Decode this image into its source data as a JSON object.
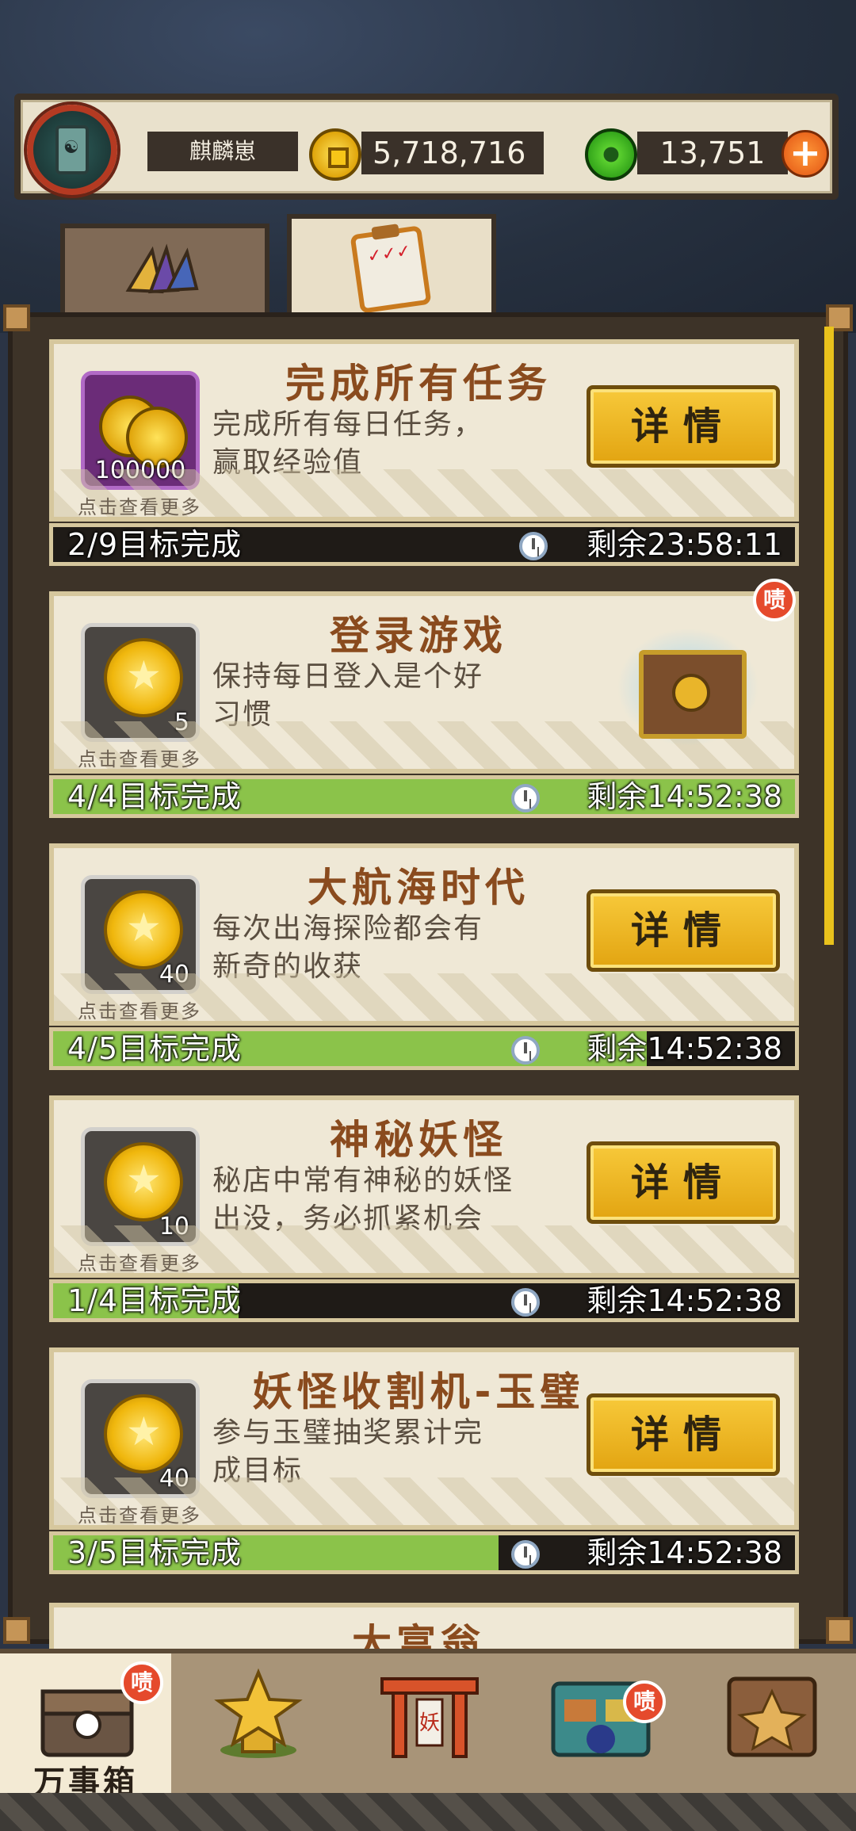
{
  "header": {
    "player_name": "麒麟崽",
    "gold": "5,718,716",
    "jade": "13,751",
    "plus_symbol": "+"
  },
  "tabs": [
    {
      "icon": "fan-icon",
      "active": false
    },
    {
      "icon": "clipboard-icon",
      "active": true
    }
  ],
  "clipboard_marks": "✓✓✓",
  "missions": [
    {
      "title": "完成所有任务",
      "desc_line1": "完成所有每日任务，",
      "desc_line2": "赢取经验值",
      "reward_count": "100000",
      "reward_icon": "coins-icon",
      "more_hint": "点击查看更多",
      "action": "详情",
      "progress_text": "2/9目标完成",
      "time_text": "剩余23:58:11",
      "progress": 0.0
    },
    {
      "title": "登录游戏",
      "desc_line1": "保持每日登入是个好",
      "desc_line2": "习惯",
      "reward_count": "5",
      "reward_icon": "medal-icon",
      "more_hint": "点击查看更多",
      "action_icon": "treasure-chest-icon",
      "badge": "啧",
      "progress_text": "4/4目标完成",
      "time_text": "剩余14:52:38",
      "progress": 1.0
    },
    {
      "title": "大航海时代",
      "desc_line1": "每次出海探险都会有",
      "desc_line2": "新奇的收获",
      "reward_count": "40",
      "reward_icon": "medal-icon",
      "more_hint": "点击查看更多",
      "action": "详情",
      "progress_text": "4/5目标完成",
      "time_text": "剩余14:52:38",
      "progress": 0.8
    },
    {
      "title": "神秘妖怪",
      "desc_line1": "秘店中常有神秘的妖怪",
      "desc_line2": "出没，务必抓紧机会",
      "reward_count": "10",
      "reward_icon": "medal-icon",
      "more_hint": "点击查看更多",
      "action": "详情",
      "progress_text": "1/4目标完成",
      "time_text": "剩余14:52:38",
      "progress": 0.25
    },
    {
      "title": "妖怪收割机-玉璧",
      "desc_line1": "参与玉璧抽奖累计完",
      "desc_line2": "成目标",
      "reward_count": "40",
      "reward_icon": "medal-icon",
      "more_hint": "点击查看更多",
      "action": "详情",
      "progress_text": "3/5目标完成",
      "time_text": "剩余14:52:38",
      "progress": 0.6
    }
  ],
  "partial_card": {
    "title": "大富翁"
  },
  "bottom_nav": [
    {
      "label": "万事箱",
      "icon": "treasure-box-icon",
      "active": true,
      "badge": "啧"
    },
    {
      "label": "",
      "icon": "star-trophy-icon",
      "active": false
    },
    {
      "label": "",
      "icon": "yokai-gate-icon",
      "active": false,
      "gate_text": "妖"
    },
    {
      "label": "",
      "icon": "shop-stall-icon",
      "active": false,
      "badge": "啧"
    },
    {
      "label": "",
      "icon": "book-icon",
      "active": false
    }
  ],
  "colors": {
    "frame": "#3d3328",
    "card": "#efe8d6",
    "button_gold": "#f0b82a",
    "progress_green": "#8bc34a",
    "badge_red": "#e54a2c"
  }
}
